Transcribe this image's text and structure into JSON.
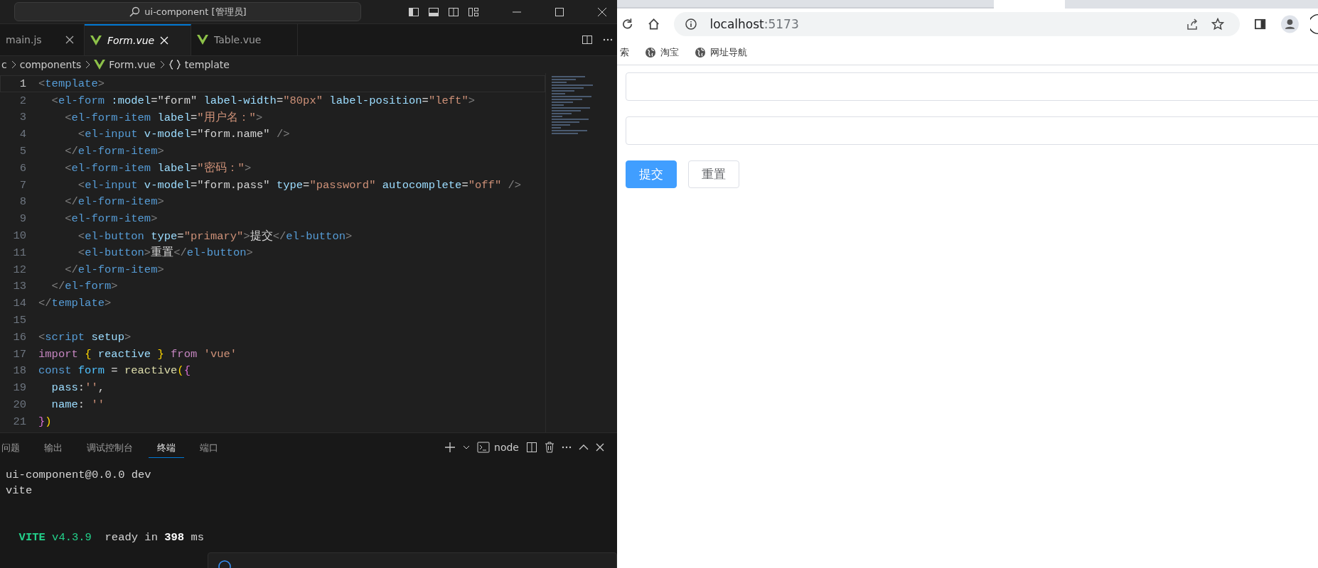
{
  "vscode": {
    "title_search": "ui-component [管理员]",
    "tabs": [
      {
        "label": "main.js",
        "selected": false,
        "closable": true,
        "kind": "js"
      },
      {
        "label": "Form.vue",
        "selected": true,
        "closable": true,
        "kind": "vue"
      },
      {
        "label": "Table.vue",
        "selected": false,
        "closable": false,
        "kind": "vue"
      }
    ],
    "breadcrumb": [
      "c",
      "components",
      "Form.vue",
      "template"
    ],
    "code_lines": [
      {
        "number": "1",
        "current": true,
        "tokens": [
          {
            "kind": "p",
            "t": "<"
          },
          {
            "kind": "tag",
            "t": "template"
          },
          {
            "kind": "p",
            "t": ">"
          }
        ]
      },
      {
        "number": "2",
        "current": false,
        "tokens": [
          {
            "kind": "p",
            "t": "  <"
          },
          {
            "kind": "tag",
            "t": "el-form "
          },
          {
            "kind": "attr",
            "t": ":model"
          },
          {
            "kind": "txt",
            "t": "=\"form\" "
          },
          {
            "kind": "attr",
            "t": "label-width"
          },
          {
            "kind": "txt",
            "t": "="
          },
          {
            "kind": "str",
            "t": "\"80px\" "
          },
          {
            "kind": "attr",
            "t": "label-position"
          },
          {
            "kind": "txt",
            "t": "="
          },
          {
            "kind": "str",
            "t": "\"left\""
          },
          {
            "kind": "p",
            "t": ">"
          }
        ]
      },
      {
        "number": "3",
        "current": false,
        "tokens": [
          {
            "kind": "p",
            "t": "    <"
          },
          {
            "kind": "tag",
            "t": "el-form-item "
          },
          {
            "kind": "attr",
            "t": "label"
          },
          {
            "kind": "txt",
            "t": "="
          },
          {
            "kind": "str",
            "t": "\"用户名：\""
          },
          {
            "kind": "p",
            "t": ">"
          }
        ]
      },
      {
        "number": "4",
        "current": false,
        "tokens": [
          {
            "kind": "p",
            "t": "      <"
          },
          {
            "kind": "tag",
            "t": "el-input "
          },
          {
            "kind": "attr",
            "t": "v-model"
          },
          {
            "kind": "txt",
            "t": "=\"form.name\" "
          },
          {
            "kind": "p",
            "t": "/>"
          }
        ]
      },
      {
        "number": "5",
        "current": false,
        "tokens": [
          {
            "kind": "p",
            "t": "    </"
          },
          {
            "kind": "tag",
            "t": "el-form-item"
          },
          {
            "kind": "p",
            "t": ">"
          }
        ]
      },
      {
        "number": "6",
        "current": false,
        "tokens": [
          {
            "kind": "p",
            "t": "    <"
          },
          {
            "kind": "tag",
            "t": "el-form-item "
          },
          {
            "kind": "attr",
            "t": "label"
          },
          {
            "kind": "txt",
            "t": "="
          },
          {
            "kind": "str",
            "t": "\"密码：\""
          },
          {
            "kind": "p",
            "t": ">"
          }
        ]
      },
      {
        "number": "7",
        "current": false,
        "tokens": [
          {
            "kind": "p",
            "t": "      <"
          },
          {
            "kind": "tag",
            "t": "el-input "
          },
          {
            "kind": "attr",
            "t": "v-model"
          },
          {
            "kind": "txt",
            "t": "=\"form.pass\" "
          },
          {
            "kind": "attr",
            "t": "type"
          },
          {
            "kind": "txt",
            "t": "="
          },
          {
            "kind": "str",
            "t": "\"password\" "
          },
          {
            "kind": "attr",
            "t": "autocomplete"
          },
          {
            "kind": "txt",
            "t": "="
          },
          {
            "kind": "str",
            "t": "\"off\" "
          },
          {
            "kind": "p",
            "t": "/>"
          }
        ]
      },
      {
        "number": "8",
        "current": false,
        "tokens": [
          {
            "kind": "p",
            "t": "    </"
          },
          {
            "kind": "tag",
            "t": "el-form-item"
          },
          {
            "kind": "p",
            "t": ">"
          }
        ]
      },
      {
        "number": "9",
        "current": false,
        "tokens": [
          {
            "kind": "p",
            "t": "    <"
          },
          {
            "kind": "tag",
            "t": "el-form-item"
          },
          {
            "kind": "p",
            "t": ">"
          }
        ]
      },
      {
        "number": "10",
        "current": false,
        "tokens": [
          {
            "kind": "p",
            "t": "      <"
          },
          {
            "kind": "tag",
            "t": "el-button "
          },
          {
            "kind": "attr",
            "t": "type"
          },
          {
            "kind": "txt",
            "t": "="
          },
          {
            "kind": "str",
            "t": "\"primary\""
          },
          {
            "kind": "p",
            "t": ">"
          },
          {
            "kind": "txt",
            "t": "提交"
          },
          {
            "kind": "p",
            "t": "</"
          },
          {
            "kind": "tag",
            "t": "el-button"
          },
          {
            "kind": "p",
            "t": ">"
          }
        ]
      },
      {
        "number": "11",
        "current": false,
        "tokens": [
          {
            "kind": "p",
            "t": "      <"
          },
          {
            "kind": "tag",
            "t": "el-button"
          },
          {
            "kind": "p",
            "t": ">"
          },
          {
            "kind": "txt",
            "t": "重置"
          },
          {
            "kind": "p",
            "t": "</"
          },
          {
            "kind": "tag",
            "t": "el-button"
          },
          {
            "kind": "p",
            "t": ">"
          }
        ]
      },
      {
        "number": "12",
        "current": false,
        "tokens": [
          {
            "kind": "p",
            "t": "    </"
          },
          {
            "kind": "tag",
            "t": "el-form-item"
          },
          {
            "kind": "p",
            "t": ">"
          }
        ]
      },
      {
        "number": "13",
        "current": false,
        "tokens": [
          {
            "kind": "p",
            "t": "  </"
          },
          {
            "kind": "tag",
            "t": "el-form"
          },
          {
            "kind": "p",
            "t": ">"
          }
        ]
      },
      {
        "number": "14",
        "current": false,
        "tokens": [
          {
            "kind": "p",
            "t": "</"
          },
          {
            "kind": "tag",
            "t": "template"
          },
          {
            "kind": "p",
            "t": ">"
          }
        ]
      },
      {
        "number": "15",
        "current": false
      },
      {
        "number": "16",
        "current": false,
        "tokens": [
          {
            "kind": "p",
            "t": "<"
          },
          {
            "kind": "tag",
            "t": "script "
          },
          {
            "kind": "attr",
            "t": "setup"
          },
          {
            "kind": "p",
            "t": ">"
          }
        ]
      },
      {
        "number": "17",
        "current": false,
        "tokens": [
          {
            "kind": "kw",
            "t": "import "
          },
          {
            "kind": "b1",
            "t": "{"
          },
          {
            "kind": "attr",
            "t": " reactive "
          },
          {
            "kind": "b1",
            "t": "}"
          },
          {
            "kind": "kw",
            "t": " from "
          },
          {
            "kind": "str",
            "t": "'vue'"
          }
        ]
      },
      {
        "number": "18",
        "current": false,
        "tokens": [
          {
            "kind": "decl",
            "t": "const "
          },
          {
            "kind": "var",
            "t": "form"
          },
          {
            "kind": "txt",
            "t": " = "
          },
          {
            "kind": "fn",
            "t": "reactive"
          },
          {
            "kind": "b1",
            "t": "("
          },
          {
            "kind": "b2",
            "t": "{"
          }
        ]
      },
      {
        "number": "19",
        "current": false,
        "tokens": [
          {
            "kind": "attr",
            "t": "  pass"
          },
          {
            "kind": "txt",
            "t": ":"
          },
          {
            "kind": "str",
            "t": "''"
          },
          {
            "kind": "txt",
            "t": ","
          }
        ]
      },
      {
        "number": "20",
        "current": false,
        "tokens": [
          {
            "kind": "attr",
            "t": "  name"
          },
          {
            "kind": "txt",
            "t": ": "
          },
          {
            "kind": "str",
            "t": "''"
          }
        ]
      },
      {
        "number": "21",
        "current": false,
        "tokens": [
          {
            "kind": "b2",
            "t": "}"
          },
          {
            "kind": "b1",
            "t": ")"
          }
        ]
      }
    ],
    "panel_tabs": [
      {
        "label": "问题",
        "selected": false
      },
      {
        "label": "输出",
        "selected": false
      },
      {
        "label": "调试控制台",
        "selected": false
      },
      {
        "label": "终端",
        "selected": true
      },
      {
        "label": "端口",
        "selected": false
      }
    ],
    "terminal_name": "node",
    "terminal_lines": [
      {
        "tokens": [
          {
            "kind": "txt",
            "t": "ui-component@0.0.0 dev"
          }
        ]
      },
      {
        "tokens": [
          {
            "kind": "txt",
            "t": "vite"
          }
        ]
      },
      {
        "tokens": [
          {
            "kind": "vitebold",
            "t": "  VITE"
          },
          {
            "kind": "vite",
            "t": " v4.3.9"
          },
          {
            "kind": "txt",
            "t": "  ready in "
          },
          {
            "kind": "bold",
            "t": "398"
          },
          {
            "kind": "txt",
            "t": " ms"
          }
        ]
      }
    ]
  },
  "browser": {
    "address_host": "localhost",
    "address_port": ":5173",
    "bookmarks": [
      {
        "label": "索",
        "icon": false
      },
      {
        "label": "淘宝",
        "icon": true
      },
      {
        "label": "网址导航",
        "icon": true
      }
    ],
    "buttons": [
      {
        "label": "提交",
        "kind": "primary"
      },
      {
        "label": "重置",
        "kind": "default"
      }
    ]
  }
}
